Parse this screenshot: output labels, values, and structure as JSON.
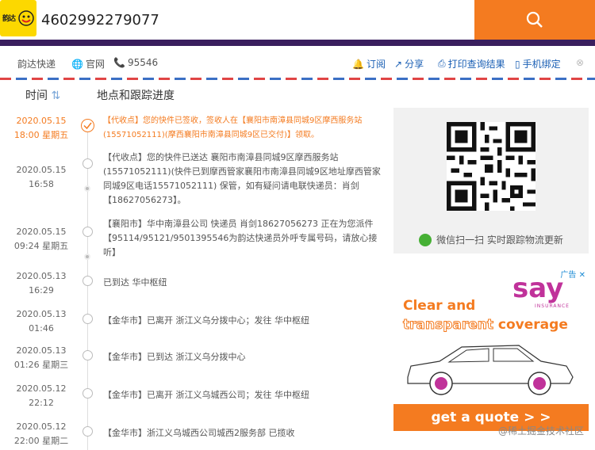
{
  "header": {
    "logo_text": "韵达",
    "tracking_number": "4602992279077",
    "search_icon": "search-icon"
  },
  "info_bar": {
    "company": "韵达快递",
    "website_label": "官网",
    "hotline": "95546",
    "actions": [
      {
        "label": "订阅",
        "icon": "bell-icon"
      },
      {
        "label": "分享",
        "icon": "share-icon"
      },
      {
        "label": "打印查询结果",
        "icon": "print-icon"
      },
      {
        "label": "手机绑定",
        "icon": "phone-icon"
      }
    ]
  },
  "list_header": {
    "time_label": "时间",
    "progress_label": "地点和跟踪进度"
  },
  "entries": [
    {
      "date": "2020.05.15",
      "time": "18:00 星期五",
      "desc": "【代收点】您的快件已签收，签收人在【襄阳市南漳县同城9区摩西服务站(15571052111)(摩西襄阳市南漳县同城9区已交付)】领取。"
    },
    {
      "date": "2020.05.15",
      "time": "16:58",
      "desc": "【代收点】您的快件已送达 襄阳市南漳县同城9区摩西服务站(15571052111)(快件已到摩西管家襄阳市南漳县同城9区地址摩西管家同城9区电话15571052111) 保管，如有疑问请电联快递员：肖剑【18627056273】。"
    },
    {
      "date": "2020.05.15",
      "time": "09:24 星期五",
      "desc": "【襄阳市】华中南漳县公司 快递员 肖剑18627056273 正在为您派件【95114/95121/9501395546为韵达快递员外呼专属号码，请放心接听】"
    },
    {
      "date": "2020.05.13",
      "time": "16:29",
      "desc": "已到达 华中枢纽"
    },
    {
      "date": "2020.05.13",
      "time": "01:46",
      "desc": "【金华市】已离开 浙江义乌分拨中心；发往 华中枢纽"
    },
    {
      "date": "2020.05.13",
      "time": "01:26 星期三",
      "desc": "【金华市】已到达 浙江义乌分拨中心"
    },
    {
      "date": "2020.05.12",
      "time": "22:12",
      "desc": "【金华市】已离开 浙江义乌城西公司；发往 华中枢纽"
    },
    {
      "date": "2020.05.12",
      "time": "22:00 星期二",
      "desc": "【金华市】浙江义乌城西公司城西2服务部 已揽收"
    }
  ],
  "qr_panel": {
    "caption": "微信扫一扫 实时跟踪物流更新"
  },
  "ad": {
    "badge": "广告",
    "brand": "say",
    "brand_sub": "INSURANCE",
    "line1": "Clear and",
    "line2_pale": "transparent",
    "line2_solid": "coverage",
    "cta": "get a quote > >"
  },
  "watermark": "@稀土掘金技术社区",
  "colors": {
    "accent": "#f47b20",
    "nav_purple": "#3a1f5e",
    "link_blue": "#1a5fb4"
  }
}
